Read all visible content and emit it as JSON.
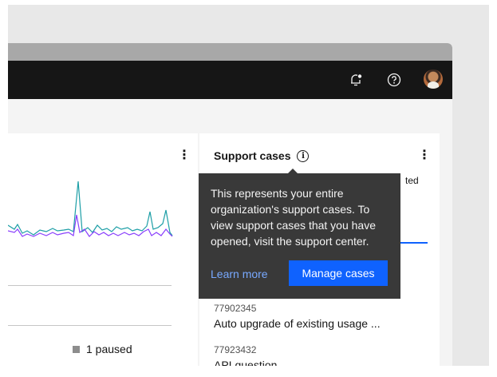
{
  "header": {
    "icons": [
      "notification-icon",
      "help-icon",
      "user-avatar"
    ]
  },
  "left_card": {
    "menu_icon": "overflow-menu-icon",
    "paused_label": "1 paused",
    "paused_color": "#8d8d8d",
    "series_colors": [
      "#1c9ea6",
      "#8a3ffc"
    ]
  },
  "support_cases": {
    "title": "Support cases",
    "info_icon": "i",
    "partial_text": "ted",
    "cases": [
      {
        "id": "77902345",
        "description": "Auto upgrade of existing usage ..."
      },
      {
        "id": "77923432",
        "description": "API question"
      }
    ]
  },
  "tooltip": {
    "text": "This represents your entire organization's support cases. To view support cases that you have opened, visit the support center.",
    "learn_more": "Learn more",
    "manage_button": "Manage cases"
  },
  "colors": {
    "nav_bg": "#161616",
    "primary": "#0f62fe",
    "link": "#78a9ff",
    "tooltip_bg": "#393939"
  }
}
